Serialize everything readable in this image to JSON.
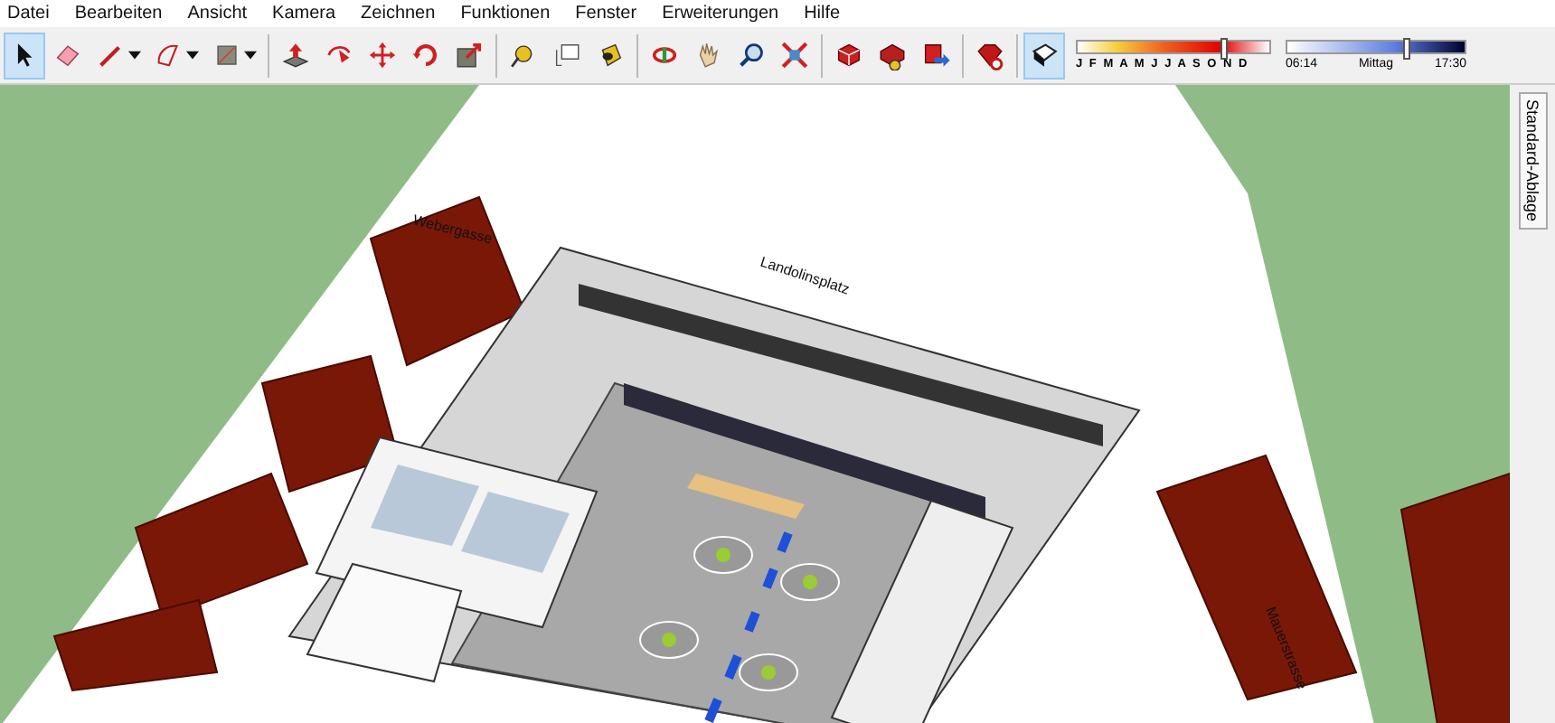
{
  "menu": [
    "Datei",
    "Bearbeiten",
    "Ansicht",
    "Kamera",
    "Zeichnen",
    "Funktionen",
    "Fenster",
    "Erweiterungen",
    "Hilfe"
  ],
  "toolbar": {
    "groups": [
      [
        {
          "kind": "select",
          "selected": true,
          "dropdown": false
        },
        {
          "kind": "eraser",
          "selected": false,
          "dropdown": false
        },
        {
          "kind": "pencil",
          "selected": false,
          "dropdown": true
        },
        {
          "kind": "arc",
          "selected": false,
          "dropdown": true
        },
        {
          "kind": "shape",
          "selected": false,
          "dropdown": true
        }
      ],
      [
        {
          "kind": "pushpull",
          "selected": false,
          "dropdown": false
        },
        {
          "kind": "followme",
          "selected": false,
          "dropdown": false
        },
        {
          "kind": "move",
          "selected": false,
          "dropdown": false
        },
        {
          "kind": "rotate",
          "selected": false,
          "dropdown": false
        },
        {
          "kind": "offset",
          "selected": false,
          "dropdown": false
        }
      ],
      [
        {
          "kind": "tape",
          "selected": false,
          "dropdown": false
        },
        {
          "kind": "text",
          "selected": false,
          "dropdown": false
        },
        {
          "kind": "paint",
          "selected": false,
          "dropdown": false
        }
      ],
      [
        {
          "kind": "orbit",
          "selected": false,
          "dropdown": false
        },
        {
          "kind": "pan",
          "selected": false,
          "dropdown": false
        },
        {
          "kind": "zoom",
          "selected": false,
          "dropdown": false
        },
        {
          "kind": "zoomext",
          "selected": false,
          "dropdown": false
        }
      ],
      [
        {
          "kind": "warehouse",
          "selected": false,
          "dropdown": false
        },
        {
          "kind": "components",
          "selected": false,
          "dropdown": false
        },
        {
          "kind": "share",
          "selected": false,
          "dropdown": false
        }
      ],
      [
        {
          "kind": "extension",
          "selected": false,
          "dropdown": false
        }
      ]
    ]
  },
  "shadows": {
    "on": true,
    "date_slider": {
      "label": "J F M A M J J A S O N D",
      "level": 0.76
    },
    "time_slider": {
      "start": "06:14",
      "middle": "Mittag",
      "end": "17:30",
      "level": 0.67
    }
  },
  "viewport": {
    "labels": [
      "Webergasse",
      "Landolinsplatz",
      "Mauerstrasse"
    ]
  },
  "side_panel": {
    "tab": "Standard-Ablage"
  }
}
